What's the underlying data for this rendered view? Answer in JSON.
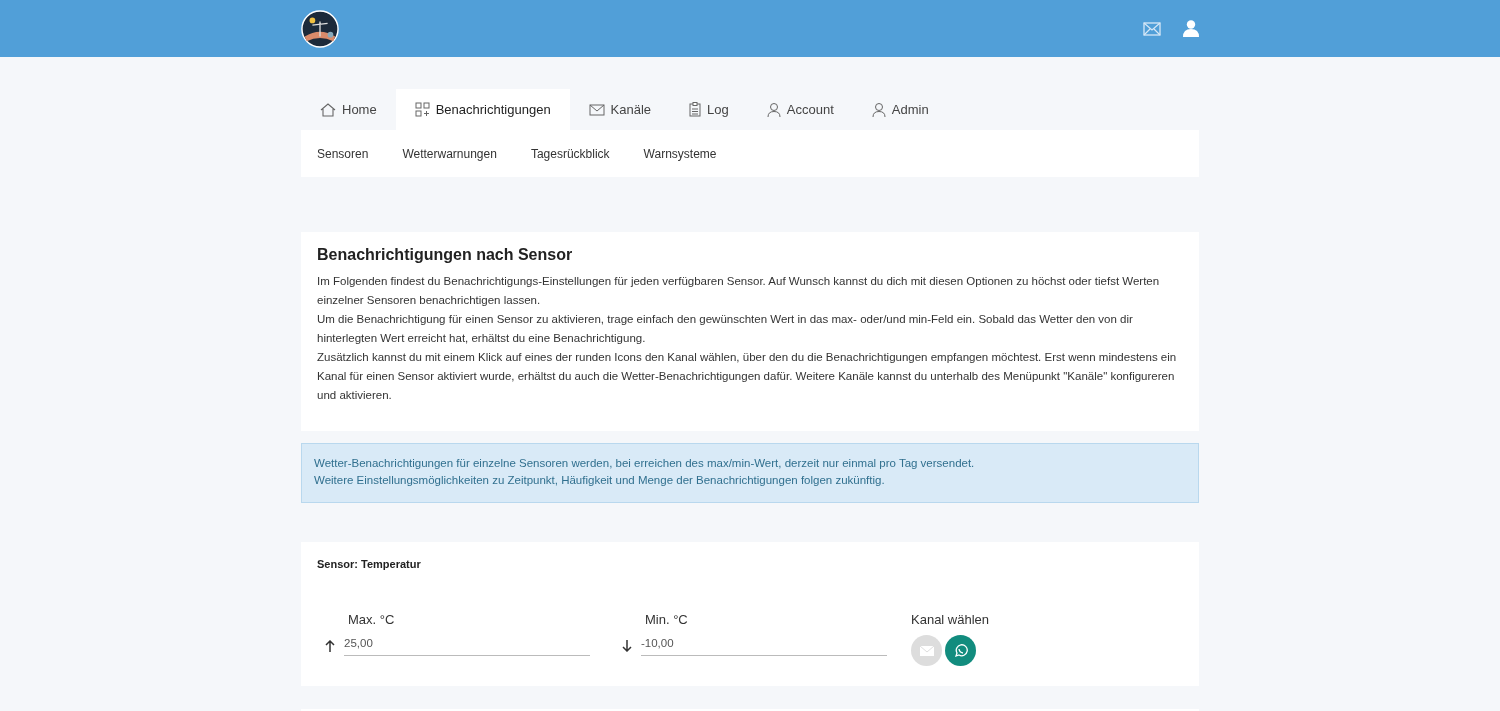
{
  "header": {
    "icons": [
      {
        "kind": "mail"
      },
      {
        "kind": "user"
      }
    ]
  },
  "tabs": [
    {
      "label": "Home",
      "kind": "home",
      "selected": false
    },
    {
      "label": "Benachrichtigungen",
      "kind": "grid",
      "selected": true
    },
    {
      "label": "Kanäle",
      "kind": "mail",
      "selected": false
    },
    {
      "label": "Log",
      "kind": "clipboard",
      "selected": false
    },
    {
      "label": "Account",
      "kind": "person",
      "selected": false
    },
    {
      "label": "Admin",
      "kind": "person",
      "selected": false
    }
  ],
  "subnav": [
    "Sensoren",
    "Wetterwarnungen",
    "Tagesrückblick",
    "Warnsysteme"
  ],
  "intro": {
    "title": "Benachrichtigungen nach Sensor",
    "paragraphs": [
      "Im Folgenden findest du Benachrichtigungs-Einstellungen für jeden verfügbaren Sensor. Auf Wunsch kannst du dich mit diesen Optionen zu höchst oder tiefst Werten einzelner Sensoren benachrichtigen lassen.",
      "Um die Benachrichtigung für einen Sensor zu aktivieren, trage einfach den gewünschten Wert in das max- oder/und min-Feld ein. Sobald das Wetter den von dir hinterlegten Wert erreicht hat, erhältst du eine Benachrichtigung.",
      "Zusätzlich kannst du mit einem Klick auf eines der runden Icons den Kanal wählen, über den du die Benachrichtigungen empfangen möchtest. Erst wenn mindestens ein Kanal für einen Sensor aktiviert wurde, erhältst du auch die Wetter-Benachrichtigungen dafür. Weitere Kanäle kannst du unterhalb des Menüpunkt \"Kanäle\" konfigureren und aktivieren."
    ]
  },
  "notice": [
    "Wetter-Benachrichtigungen für einzelne Sensoren werden, bei erreichen des max/min-Wert, derzeit nur einmal pro Tag versendet.",
    "Weitere Einstellungsmöglichkeiten zu Zeitpunkt, Häufigkeit und Menge der Benachrichtigungen folgen zukünftig."
  ],
  "sensors": [
    {
      "title": "Sensor: Temperatur",
      "fields": [
        {
          "kind": "max",
          "label": "Max. °C",
          "value": "25,00"
        },
        {
          "kind": "min",
          "label": "Min. °C",
          "value": "-10,00"
        }
      ],
      "channel_label": "Kanal wählen",
      "channels": [
        {
          "kind": "mail",
          "on": false
        },
        {
          "kind": "whatsapp",
          "on": true
        }
      ]
    }
  ]
}
